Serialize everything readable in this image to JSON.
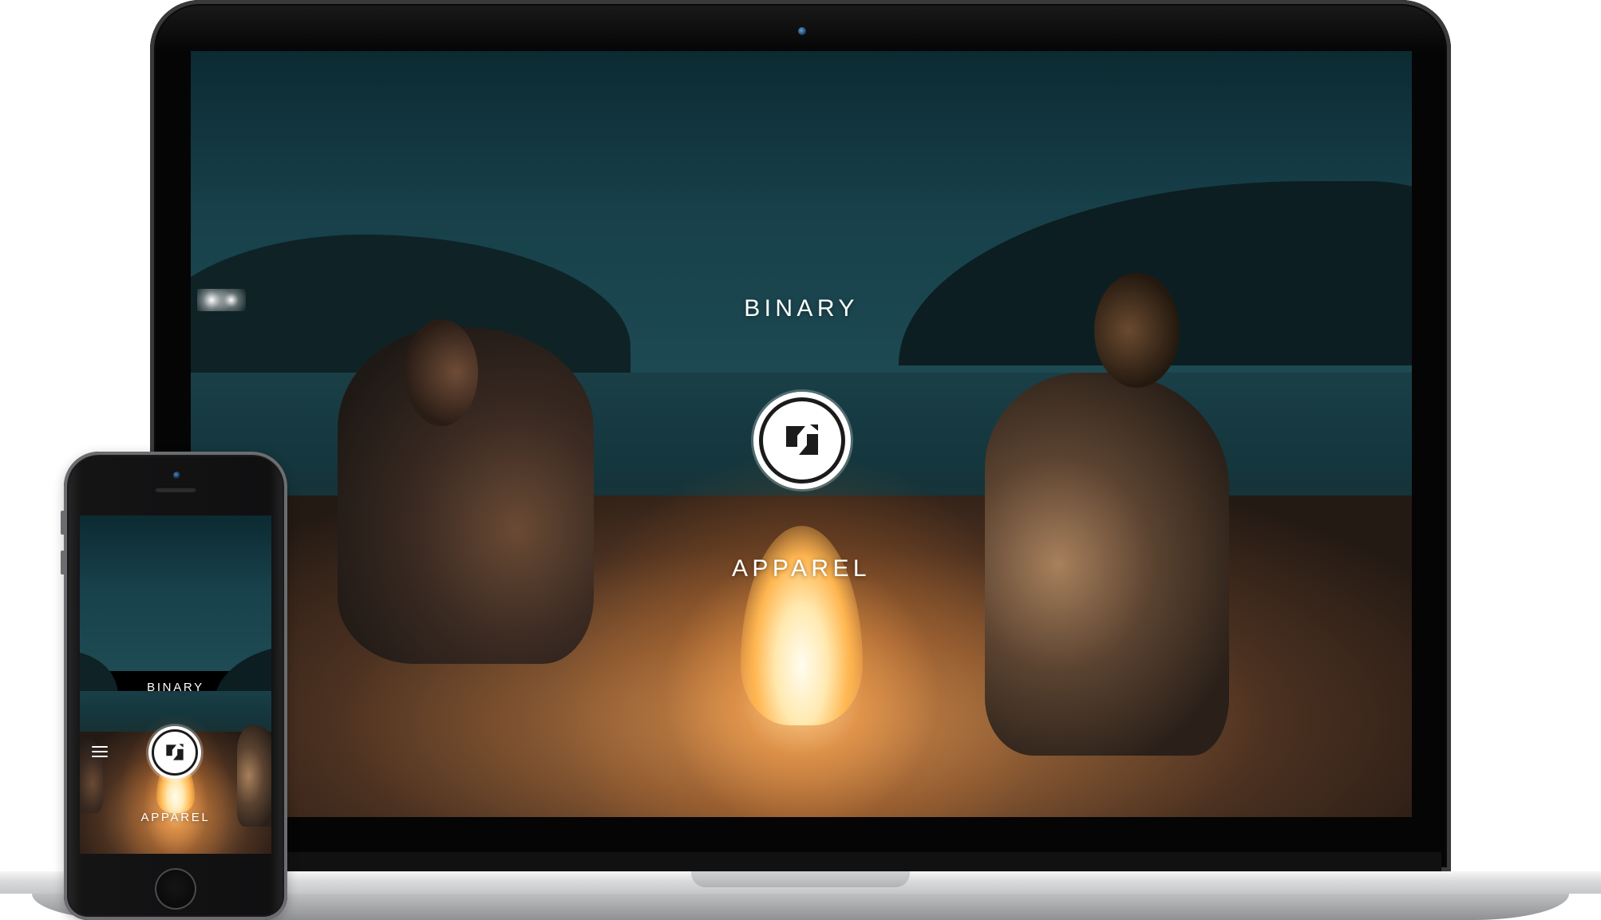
{
  "laptop": {
    "hero": {
      "title": "BINARY",
      "subtitle": "APPAREL",
      "logo_icon": "binary-apparel-logo-icon"
    }
  },
  "phone": {
    "hero": {
      "title": "BINARY",
      "subtitle": "APPAREL",
      "logo_icon": "binary-apparel-logo-icon"
    },
    "menu_icon": "hamburger-menu-icon"
  },
  "colors": {
    "brand_text": "#ffffff",
    "logo_background": "#ffffff",
    "logo_mark": "#1b1b1b",
    "sky": "#17404a",
    "sand_glow": "#c9925a"
  }
}
